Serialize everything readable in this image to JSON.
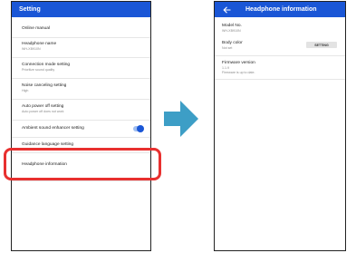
{
  "left_screen": {
    "title": "Setting",
    "items": [
      {
        "label": "Online manual",
        "sub": ""
      },
      {
        "label": "Headphone name",
        "sub": "WH-XB910N"
      },
      {
        "label": "Connection mode setting",
        "sub": "Prioritize sound quality"
      },
      {
        "label": "Noise canceling setting",
        "sub": "High"
      },
      {
        "label": "Auto power off setting",
        "sub": "Auto power off does not work"
      },
      {
        "label": "Ambient sound enhancer setting",
        "sub": ""
      },
      {
        "label": "Guidance language setting",
        "sub": ""
      },
      {
        "label": "Headphone information",
        "sub": ""
      }
    ],
    "ambient_toggle_on": true
  },
  "right_screen": {
    "title": "Headphone information",
    "back_icon": "arrow-left-icon",
    "model": {
      "label": "Model No.",
      "value": "WH-XB910N"
    },
    "body_color": {
      "label": "Body color",
      "value": "Not set",
      "button": "SETTING"
    },
    "firmware": {
      "label": "Firmware version",
      "value": "1.1.9",
      "status": "Firmware is up to date."
    }
  },
  "colors": {
    "app_bar": "#1a56d6",
    "highlight": "#e8302f",
    "arrow": "#3d9ec6"
  }
}
